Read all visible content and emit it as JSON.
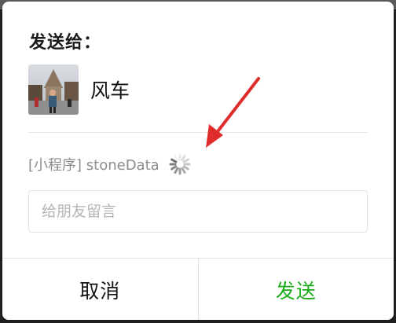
{
  "dialog": {
    "title": "发送给：",
    "recipient": {
      "name": "风车",
      "avatar_icon": "user-photo-avatar"
    },
    "share_card": {
      "text": "[小程序] stoneData",
      "status_icon": "loading-spinner-icon"
    },
    "message": {
      "placeholder": "给朋友留言",
      "value": ""
    },
    "buttons": {
      "cancel_label": "取消",
      "confirm_label": "发送"
    }
  },
  "colors": {
    "confirm": "#1aad19",
    "annotation_arrow": "#e02b2b",
    "secondary_text": "#8c8c8c"
  }
}
